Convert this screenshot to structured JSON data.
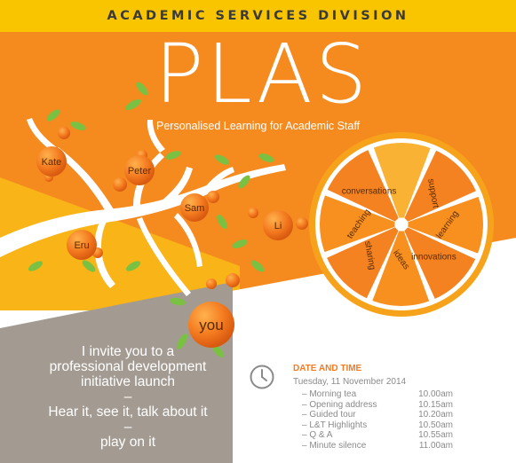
{
  "header": {
    "division": "ACADEMIC SERVICES DIVISION"
  },
  "hero": {
    "title": "PLAS",
    "subtitle": "Personalised Learning for Academic Staff"
  },
  "tree": {
    "people": [
      "Kate",
      "Peter",
      "Sam",
      "Li",
      "Eru",
      "you"
    ]
  },
  "citrus": {
    "segments": [
      "conversations",
      "support",
      "learning",
      "innovations",
      "ideas",
      "sharing",
      "teaching"
    ]
  },
  "invite": {
    "line1": "I invite you to a",
    "line2": "professional development",
    "line3": "initiative launch",
    "dash1": "–",
    "line4": "Hear it, see it, talk about it",
    "dash2": "–",
    "line5": "play on it"
  },
  "event": {
    "icon": "clock-icon",
    "heading": "DATE AND TIME",
    "date": "Tuesday, 11 November 2014",
    "schedule": [
      {
        "item": "Morning tea",
        "time": "10.00am"
      },
      {
        "item": "Opening address",
        "time": "10.15am"
      },
      {
        "item": "Guided tour",
        "time": "10.20am"
      },
      {
        "item": "L&T Highlights",
        "time": "10.50am"
      },
      {
        "item": "Q & A",
        "time": "10.55am"
      },
      {
        "item": "Minute silence",
        "time": "11.00am"
      }
    ]
  },
  "colors": {
    "header_yellow": "#f9c400",
    "orange": "#f58220",
    "orange_light": "#f7a21b",
    "taupe": "#a39b92",
    "leaf_green": "#7ac143"
  }
}
